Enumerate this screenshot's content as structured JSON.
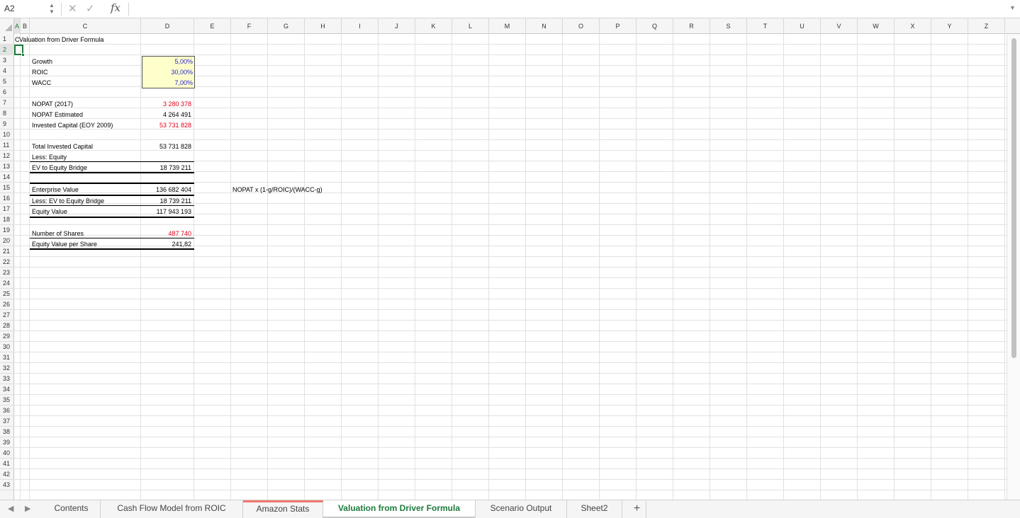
{
  "formula_bar": {
    "name_box": "A2",
    "formula": "",
    "icons": {
      "cancel": "✕",
      "enter": "✓",
      "fx": "fx",
      "expand": "▼",
      "stepper": "▲▼"
    }
  },
  "columns": [
    "A",
    "B",
    "C",
    "D",
    "E",
    "F",
    "G",
    "H",
    "I",
    "J",
    "K",
    "L",
    "M",
    "N",
    "O",
    "P",
    "Q",
    "R",
    "S",
    "T",
    "U",
    "V",
    "W",
    "X",
    "Y",
    "Z"
  ],
  "rows": [
    "1",
    "2",
    "3",
    "4",
    "5",
    "6",
    "7",
    "8",
    "9",
    "10",
    "11",
    "12",
    "13",
    "14",
    "15",
    "16",
    "17",
    "18",
    "19",
    "20",
    "21",
    "22",
    "23",
    "24",
    "25",
    "26",
    "27",
    "28",
    "29",
    "30",
    "31",
    "32",
    "33",
    "34",
    "35",
    "36",
    "37",
    "38",
    "39",
    "40",
    "41",
    "42",
    "43"
  ],
  "active_cell": {
    "column": "A",
    "row": "2"
  },
  "sheet": {
    "title_prefix": "C",
    "title": "Valuation from Driver Formula",
    "inputs": {
      "growth_label": "Growth",
      "growth_value": "5,00%",
      "roic_label": "ROIC",
      "roic_value": "30,00%",
      "wacc_label": "WACC",
      "wacc_value": "7,00%"
    },
    "nopat": {
      "nopat_2017_label": "NOPAT (2017)",
      "nopat_2017_value": "3 280 378",
      "nopat_est_label": "NOPAT Estimated",
      "nopat_est_value": "4 264 491",
      "invested_capital_label": "Invested Capital (EOY 2009)",
      "invested_capital_value": "53 731 828"
    },
    "bridge": {
      "total_ic_label": "Total Invested Capital",
      "total_ic_value": "53 731 828",
      "less_equity_label": "Less: Equity",
      "less_equity_value": "",
      "ev_equity_bridge_label": "EV to Equity Bridge",
      "ev_equity_bridge_value": "18 739 211"
    },
    "valuation": {
      "ev_label": "Enterprise Value",
      "ev_value": "136 682 404",
      "less_bridge_label": "Less: EV to Equity Bridge",
      "less_bridge_value": "18 739 211",
      "equity_value_label": "Equity Value",
      "equity_value_value": "117 943 193",
      "formula_note": "NOPAT x (1-g/ROIC)/(WACC-g)"
    },
    "shares": {
      "num_shares_label": "Number of Shares",
      "num_shares_value": "487 740",
      "per_share_label": "Equity Value per Share",
      "per_share_value": "241,82"
    }
  },
  "tabs": {
    "prev_icon": "◀",
    "next_icon": "▶",
    "items": [
      "Contents",
      "Cash Flow Model from ROIC",
      "Amazon Stats",
      "Valuation from Driver Formula",
      "Scenario Output",
      "Sheet2"
    ],
    "active": "Valuation from Driver Formula",
    "add_icon": "+"
  },
  "colors": {
    "accent": "#1d7a3c",
    "input_fill": "#ffffcc",
    "hardcoded": "#e0001b",
    "input_text": "#1f1fd6",
    "tab_marker": "#f07771"
  }
}
